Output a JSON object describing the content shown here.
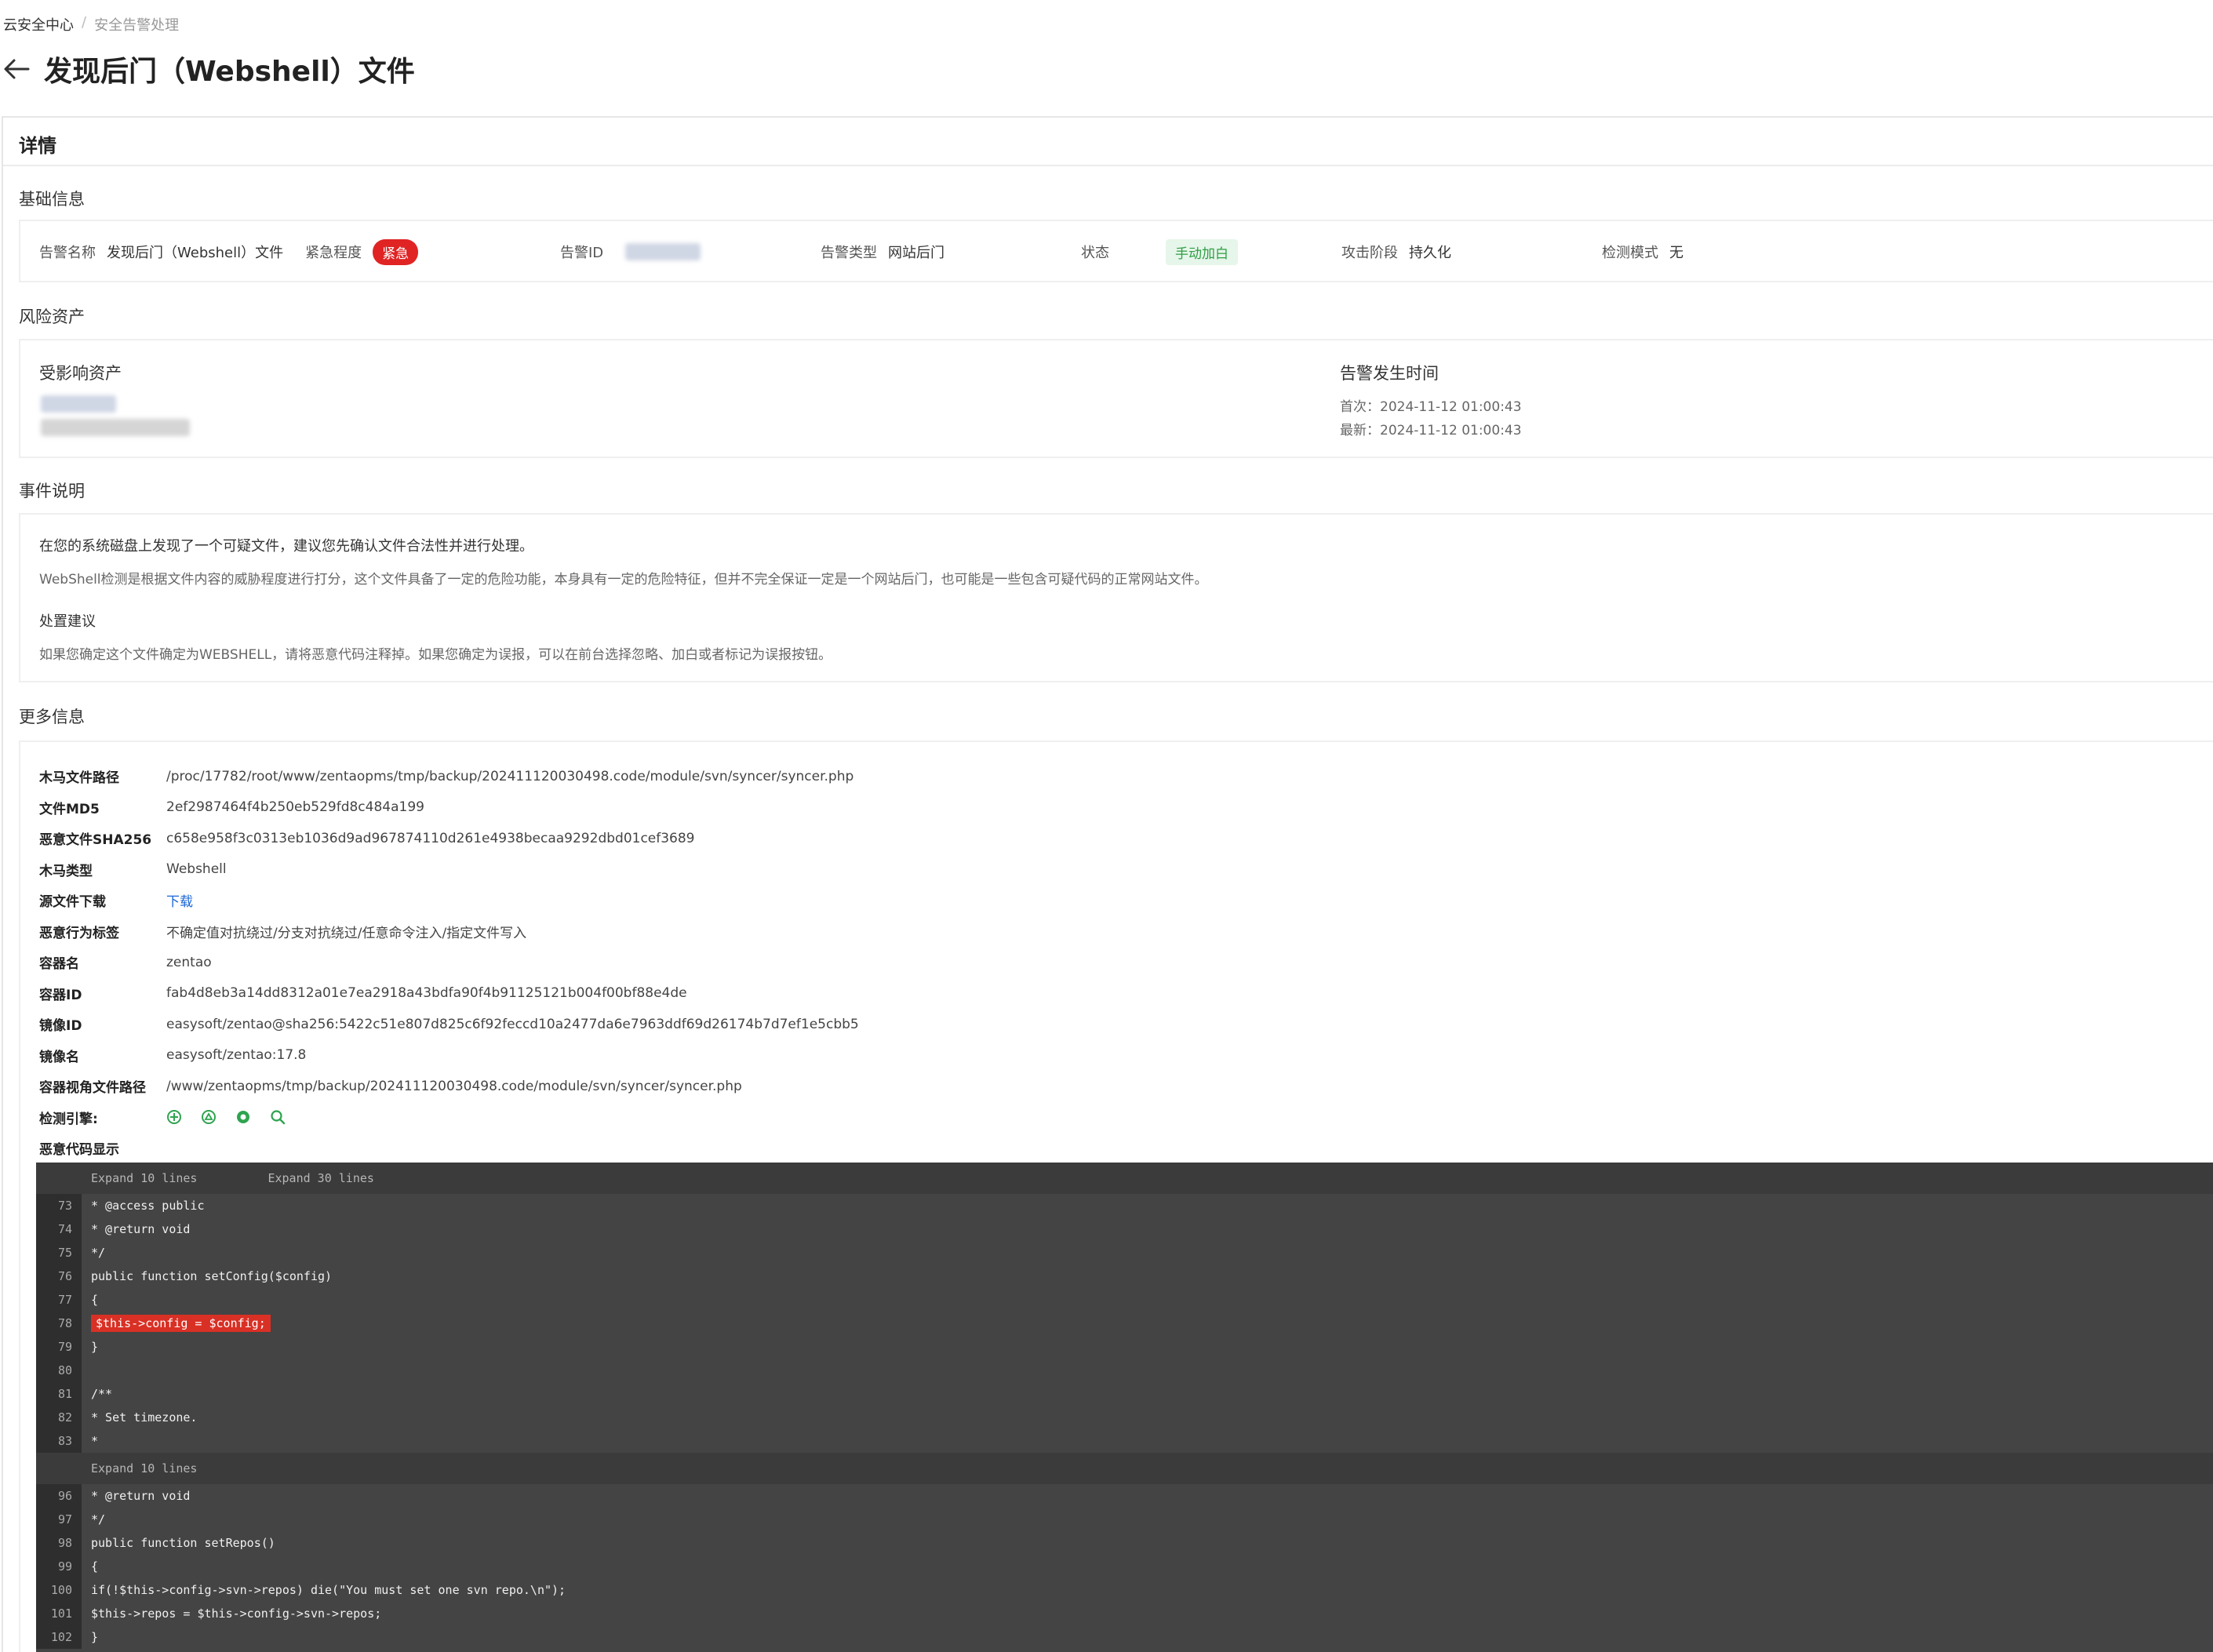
{
  "breadcrumb": {
    "root": "云安全中心",
    "sep": "/",
    "current": "安全告警处理"
  },
  "page": {
    "title": "发现后门（Webshell）文件"
  },
  "panel": {
    "title": "详情"
  },
  "basic": {
    "title": "基础信息",
    "alert_name_label": "告警名称",
    "alert_name": "发现后门（Webshell）文件",
    "urgency_label": "紧急程度",
    "urgency": "紧急",
    "alert_id_label": "告警ID",
    "alert_type_label": "告警类型",
    "alert_type": "网站后门",
    "status_label": "状态",
    "status": "手动加白",
    "stage_label": "攻击阶段",
    "stage": "持久化",
    "mode_label": "检测模式",
    "mode": "无"
  },
  "risk": {
    "title": "风险资产",
    "asset_label": "受影响资产",
    "time_label": "告警发生时间",
    "first": "首次：2024-11-12 01:00:43",
    "latest": "最新：2024-11-12 01:00:43"
  },
  "event": {
    "title": "事件说明",
    "line1": "在您的系统磁盘上发现了一个可疑文件，建议您先确认文件合法性并进行处理。",
    "line2": "WebShell检测是根据文件内容的威胁程度进行打分，这个文件具备了一定的危险功能，本身具有一定的危险特征，但并不完全保证一定是一个网站后门，也可能是一些包含可疑代码的正常网站文件。",
    "advice_title": "处置建议",
    "advice": "如果您确定这个文件确定为WEBSHELL，请将恶意代码注释掉。如果您确定为误报，可以在前台选择忽略、加白或者标记为误报按钮。"
  },
  "more": {
    "title": "更多信息",
    "rows": [
      {
        "k": "木马文件路径",
        "v": "/proc/17782/root/www/zentaopms/tmp/backup/202411120030498.code/module/svn/syncer/syncer.php"
      },
      {
        "k": "文件MD5",
        "v": "2ef2987464f4b250eb529fd8c484a199"
      },
      {
        "k": "恶意文件SHA256",
        "v": "c658e958f3c0313eb1036d9ad967874110d261e4938becaa9292dbd01cef3689"
      },
      {
        "k": "木马类型",
        "v": "Webshell"
      },
      {
        "k": "源文件下载",
        "v": "下载"
      },
      {
        "k": "恶意行为标签",
        "v": "不确定值对抗绕过/分支对抗绕过/任意命令注入/指定文件写入"
      },
      {
        "k": "容器名",
        "v": "zentao"
      },
      {
        "k": "容器ID",
        "v": "fab4d8eb3a14dd8312a01e7ea2918a43bdfa90f4b91125121b004f00bf88e4de"
      },
      {
        "k": "镜像ID",
        "v": "easysoft/zentao@sha256:5422c51e807d825c6f92feccd10a2477da6e7963ddf69d26174b7d7ef1e5cbb5"
      },
      {
        "k": "镜像名",
        "v": "easysoft/zentao:17.8"
      },
      {
        "k": "容器视角文件路径",
        "v": "/www/zentaopms/tmp/backup/202411120030498.code/module/svn/syncer/syncer.php"
      }
    ],
    "engine_label": "检测引擎:",
    "code_label": "恶意代码显示"
  },
  "code": {
    "expand10": "Expand 10 lines",
    "expand30": "Expand 30 lines",
    "lines_a": [
      {
        "n": "73",
        "t": "* @access public"
      },
      {
        "n": "74",
        "t": "* @return void"
      },
      {
        "n": "75",
        "t": "*/"
      },
      {
        "n": "76",
        "t": "public function setConfig($config)"
      },
      {
        "n": "77",
        "t": "{"
      },
      {
        "n": "78",
        "t": "$this->config = $config;"
      },
      {
        "n": "79",
        "t": "}"
      },
      {
        "n": "80",
        "t": ""
      },
      {
        "n": "81",
        "t": "/**"
      },
      {
        "n": "82",
        "t": "* Set timezone."
      },
      {
        "n": "83",
        "t": "*"
      }
    ],
    "lines_b": [
      {
        "n": "96",
        "t": "* @return void"
      },
      {
        "n": "97",
        "t": "*/"
      },
      {
        "n": "98",
        "t": "public function setRepos()"
      },
      {
        "n": "99",
        "t": "{"
      },
      {
        "n": "100",
        "t": "if(!$this->config->svn->repos) die(\"You must set one svn repo.\\n\");"
      },
      {
        "n": "101",
        "t": "$this->repos = $this->config->svn->repos;"
      },
      {
        "n": "102",
        "t": "}"
      }
    ]
  }
}
